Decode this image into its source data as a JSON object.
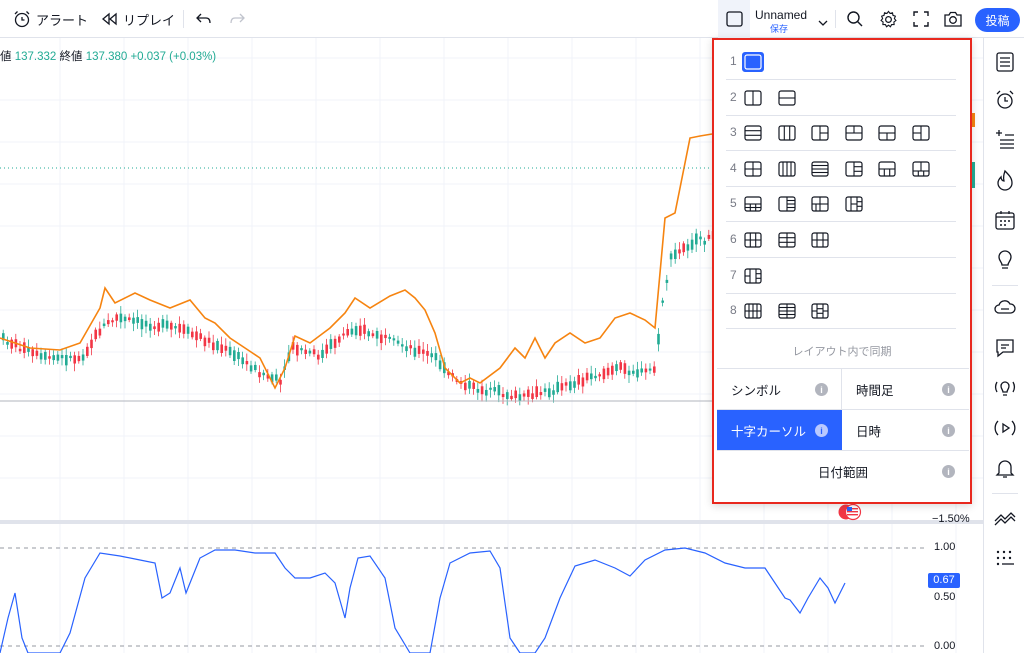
{
  "toolbar": {
    "alert_label": "アラート",
    "replay_label": "リプレイ",
    "layout_name": "Unnamed",
    "layout_save": "保存",
    "publish_label": "投稿"
  },
  "legend": {
    "prefix": "値",
    "open_value": "137.332",
    "close_label": "終値",
    "close_value": "137.380",
    "change": "+0.037 (+0.03%)"
  },
  "price_scale": {
    "main_pct": "−1.50%",
    "osc_high": "1.00",
    "osc_current": "0.67",
    "osc_mid": "0.50",
    "osc_low": "0.00",
    "osc_current_color": "#2962ff"
  },
  "layout_panel": {
    "rows": [
      {
        "num": "1"
      },
      {
        "num": "2"
      },
      {
        "num": "3"
      },
      {
        "num": "4"
      },
      {
        "num": "5"
      },
      {
        "num": "6"
      },
      {
        "num": "7"
      },
      {
        "num": "8"
      }
    ],
    "sync_title": "レイアウト内で同期",
    "sync_options": {
      "symbol": "シンボル",
      "interval": "時間足",
      "crosshair": "十字カーソル",
      "datetime": "日時",
      "date_range": "日付範囲"
    },
    "active_option": "crosshair"
  },
  "colors": {
    "accent": "#2962ff",
    "highlight_border": "#e8281e",
    "line_orange": "#f68410",
    "up_candle": "#22ab94",
    "down_candle": "#f23645",
    "oscillator": "#2962ff"
  }
}
